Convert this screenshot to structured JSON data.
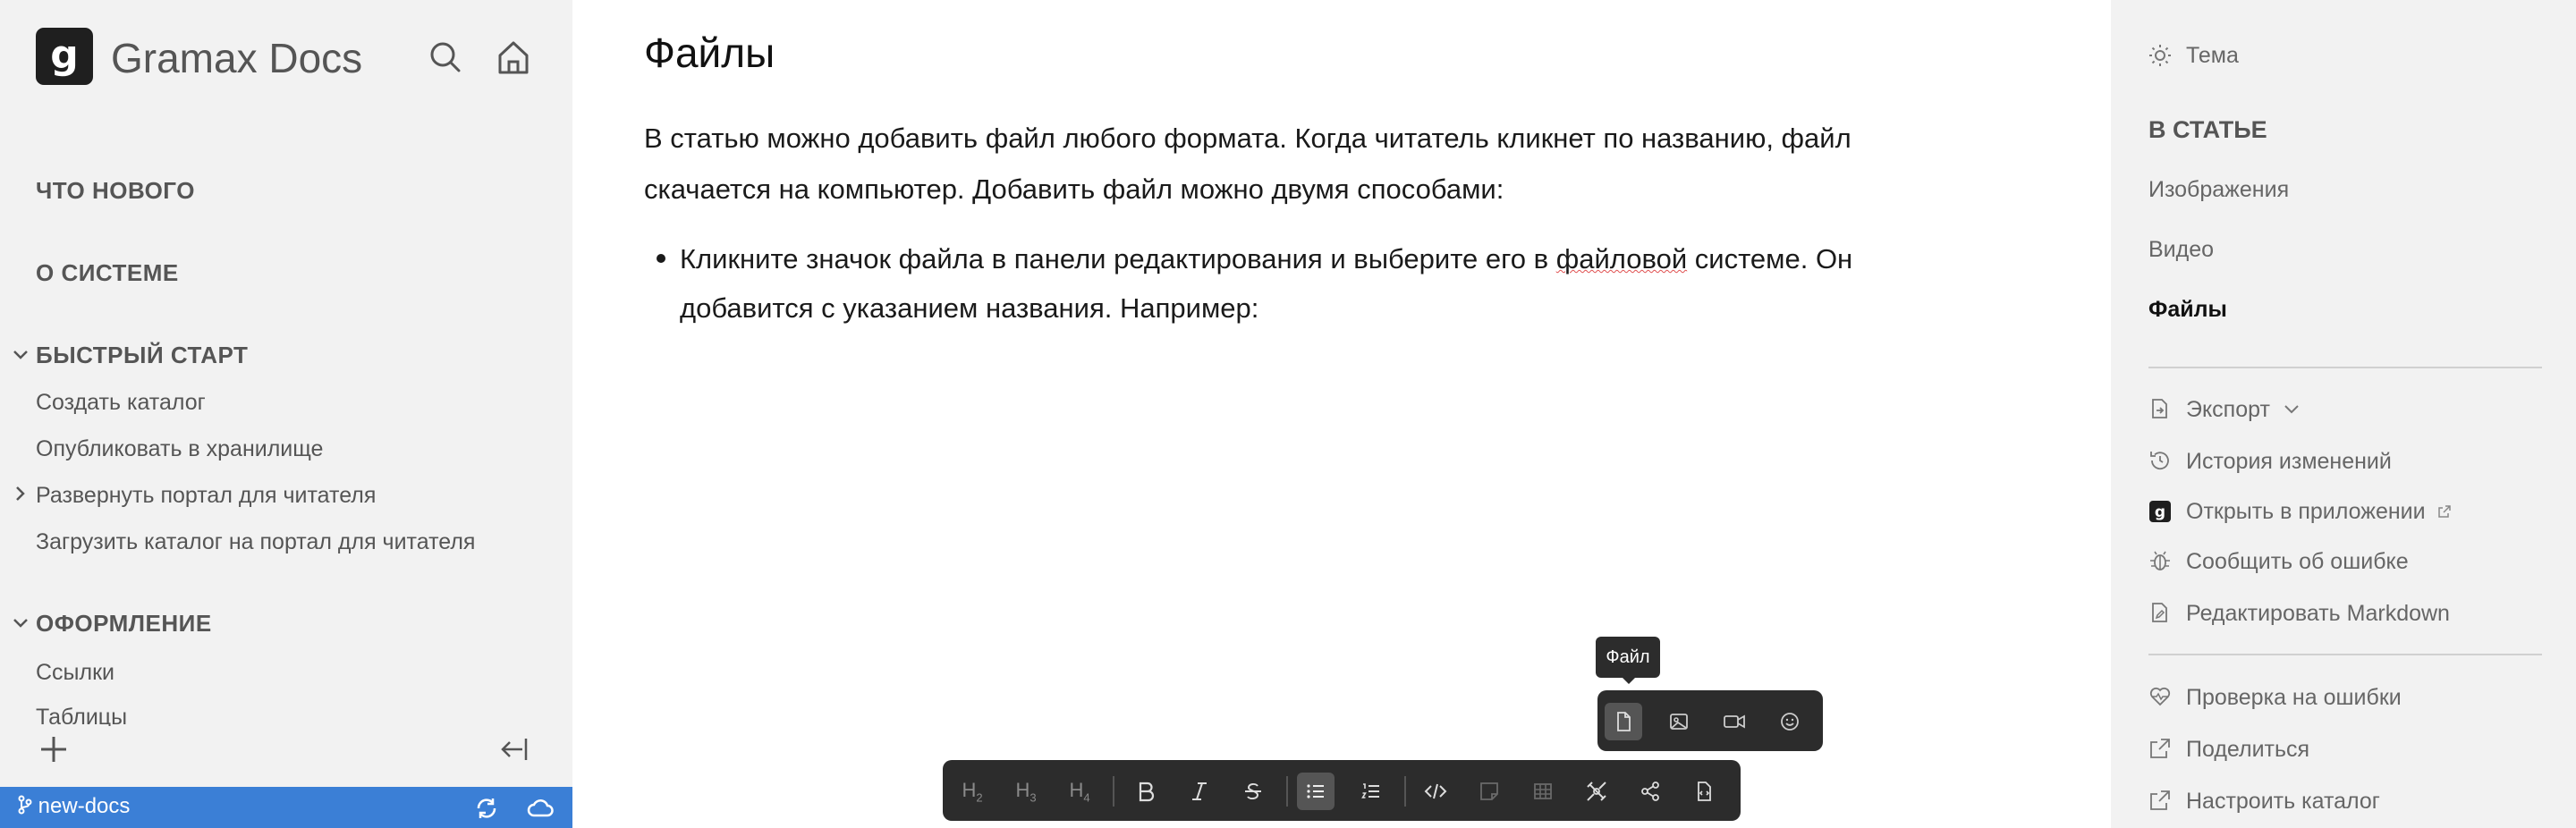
{
  "app": {
    "title": "Gramax Docs",
    "logo_letter": "g"
  },
  "left_nav": {
    "sections": [
      {
        "label": "ЧТО НОВОГО"
      },
      {
        "label": "О СИСТЕМЕ"
      },
      {
        "label": "БЫСТРЫЙ СТАРТ"
      },
      {
        "label": "ОФОРМЛЕНИЕ"
      }
    ],
    "items": [
      {
        "label": "Создать каталог"
      },
      {
        "label": "Опубликовать в хранилище"
      },
      {
        "label": "Развернуть портал для читателя"
      },
      {
        "label": "Загрузить каталог на портал для читателя"
      },
      {
        "label": "Ссылки"
      },
      {
        "label": "Таблицы"
      }
    ]
  },
  "status_bar": {
    "branch": "new-docs"
  },
  "article": {
    "title": "Файлы",
    "paragraph": "В статью можно добавить файл любого формата. Когда читатель кликнет по названию, файл скачается на компьютер. Добавить файл можно двумя способами:",
    "bullet_before": "Кликните значок файла в панели редактирования и выберите его в ",
    "bullet_underlined": "файловой",
    "bullet_after": " системе. Он добавится с указанием названия. Например:"
  },
  "tooltip": {
    "text": "Файл"
  },
  "toolbar": {
    "h2": "H",
    "h2_sub": "2",
    "h3": "H",
    "h3_sub": "3",
    "h4": "H",
    "h4_sub": "4"
  },
  "right_panel": {
    "theme_label": "Тема",
    "toc_heading": "В СТАТЬЕ",
    "toc": [
      {
        "label": "Изображения"
      },
      {
        "label": "Видео"
      },
      {
        "label": "Файлы"
      }
    ],
    "actions": [
      {
        "label": "Экспорт"
      },
      {
        "label": "История изменений"
      },
      {
        "label": "Открыть в приложении"
      },
      {
        "label": "Сообщить об ошибке"
      },
      {
        "label": "Редактировать Markdown"
      }
    ],
    "tools": [
      {
        "label": "Проверка на ошибки"
      },
      {
        "label": "Поделиться"
      },
      {
        "label": "Настроить каталог"
      }
    ]
  },
  "colors": {
    "status_bar": "#3b7fd6",
    "sidebar_bg": "#f2f2f2",
    "toolbar_bg": "#2c2c2c"
  }
}
